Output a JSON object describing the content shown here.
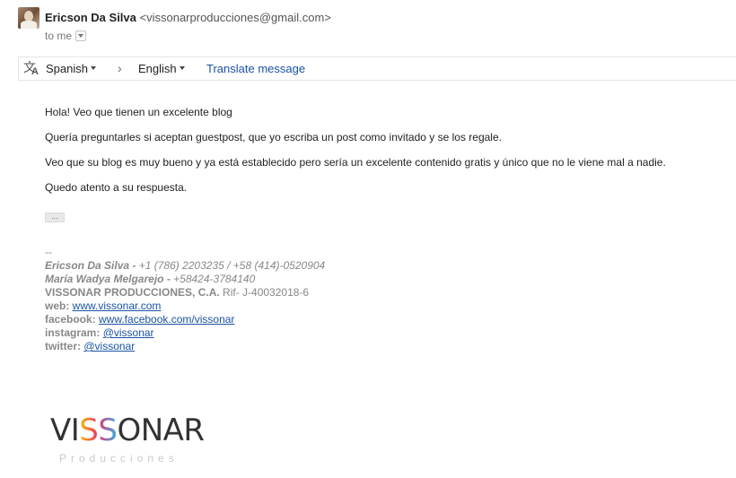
{
  "message": {
    "sender_name": "Ericson Da Silva",
    "sender_email": "<vissonarproducciones@gmail.com>",
    "recipient_line": "to me"
  },
  "translate_bar": {
    "source_language": "Spanish",
    "target_language": "English",
    "translate_link": "Translate message"
  },
  "body": {
    "paragraphs": [
      "Hola! Veo que tienen un excelente blog",
      "Quería preguntarles si aceptan guestpost, que yo escriba un post como invitado y se los regale.",
      "Veo que su blog es muy bueno y ya está establecido pero sería un excelente contenido gratis y único que no le viene mal a nadie.",
      "Quedo atento a su respuesta."
    ],
    "ellipsis": "..."
  },
  "signature": {
    "separator": "--",
    "line1_name": "Ericson Da Silva - ",
    "line1_phone": " +1 (786) 2203235 / +58 (414)-0520904",
    "line2_name": "María Wadya Melgarejo - ",
    "line2_phone": "+58424-3784140",
    "company": "VISSONAR PRODUCCIONES, C.A.",
    "rif": " Rif- J-40032018-6",
    "web_label": "web: ",
    "web_url": "www.vissonar.com",
    "facebook_label": "facebook: ",
    "facebook_url": "www.facebook.com/vissonar",
    "instagram_label": "instagram: ",
    "instagram_handle": "@vissonar",
    "twitter_label": "twitter: ",
    "twitter_handle": "@vissonar"
  },
  "logo": {
    "wordmark_left": "VI",
    "wordmark_ss": "SS",
    "wordmark_right": "ONAR",
    "subtitle": "Producciones"
  },
  "colors": {
    "link": "#1a53a6",
    "signature_gray": "#888888",
    "divider": "#e5e5e5"
  },
  "icons": {
    "translate": "translate-icon",
    "dropdown": "caret-down-icon",
    "arrow": "chevron-right-icon"
  }
}
